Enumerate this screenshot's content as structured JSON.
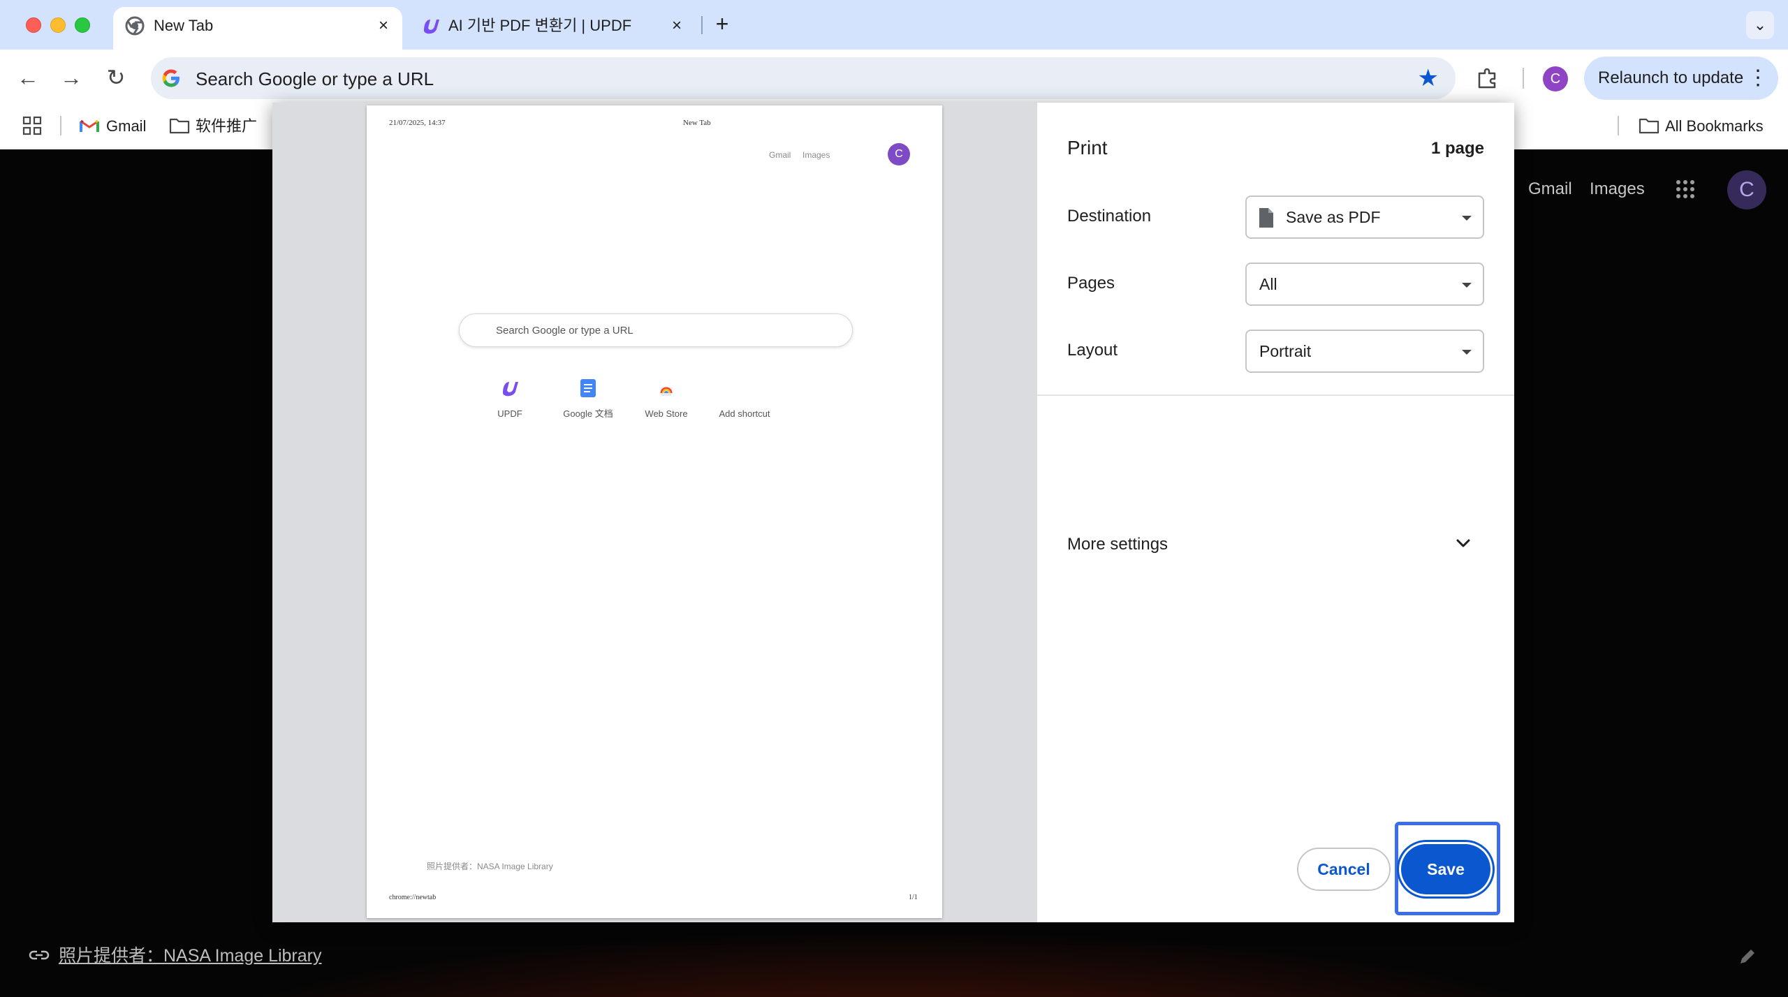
{
  "tabs": [
    {
      "title": "New Tab",
      "close": "×"
    },
    {
      "title": "AI 기반 PDF 변환기 | UPDF",
      "close": "×"
    }
  ],
  "new_tab_label": "+",
  "tab_search_label": "⌄",
  "toolbar": {
    "back": "←",
    "forward": "→",
    "reload": "↻",
    "omnibox_text": "Search Google or type a URL",
    "star": "★",
    "profile_initial": "C",
    "relaunch_label": "Relaunch to update",
    "menu": "⋮"
  },
  "bookmarks": {
    "items": [
      {
        "label": "Gmail",
        "icon": "gmail-icon"
      },
      {
        "label": "软件推广",
        "icon": "folder-icon"
      }
    ],
    "all_bookmarks": "All Bookmarks"
  },
  "ntp": {
    "gmail": "Gmail",
    "images": "Images",
    "avatar": "C",
    "attribution": "照片提供者：NASA Image Library"
  },
  "preview": {
    "header_date": "21/07/2025, 14:37",
    "header_title": "New Tab",
    "gmail": "Gmail",
    "images": "Images",
    "avatar": "C",
    "search_placeholder": "Search Google or type a URL",
    "shortcuts": [
      {
        "label": "UPDF"
      },
      {
        "label": "Google 文档"
      },
      {
        "label": "Web Store"
      },
      {
        "label": "Add shortcut"
      }
    ],
    "attribution": "照片提供者：NASA Image Library",
    "footer_url": "chrome://newtab",
    "footer_page": "1/1"
  },
  "print": {
    "title": "Print",
    "page_count": "1 page",
    "destination_label": "Destination",
    "destination_value": "Save as PDF",
    "pages_label": "Pages",
    "pages_value": "All",
    "layout_label": "Layout",
    "layout_value": "Portrait",
    "more_settings": "More settings",
    "cancel": "Cancel",
    "save": "Save"
  },
  "colors": {
    "accent": "#0b57d0",
    "tabbar": "#d3e3fd",
    "highlight": "#3b6ee8"
  }
}
